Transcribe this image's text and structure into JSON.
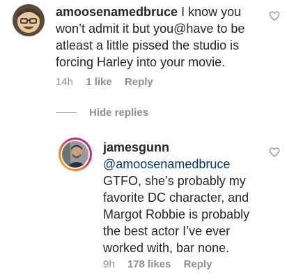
{
  "comment": {
    "username": "amoosenamedbruce",
    "text": " I know you won’t admit it but you@have to be atleast a little pissed the studio is forcing Harley into your movie.",
    "time": "14h",
    "likes": "1 like",
    "reply_label": "Reply",
    "avatar_icon": "cartoon-face-avatar",
    "like_icon": "heart-outline-icon"
  },
  "hide_replies": "Hide replies",
  "reply": {
    "username": "jamesgunn",
    "mention": "@amoosenamedbruce",
    "text": " GTFO, she’s probably my favorite DC character, and Margot Robbie is probably the best actor I’ve ever worked with, bar none.",
    "time": "9h",
    "likes": "178 likes",
    "reply_label": "Reply",
    "avatar_icon": "profile-photo-avatar",
    "like_icon": "heart-outline-icon"
  },
  "colors": {
    "text": "#262626",
    "muted": "#8e8e8e",
    "mention": "#00376b",
    "story_ring": "#d8256f"
  }
}
